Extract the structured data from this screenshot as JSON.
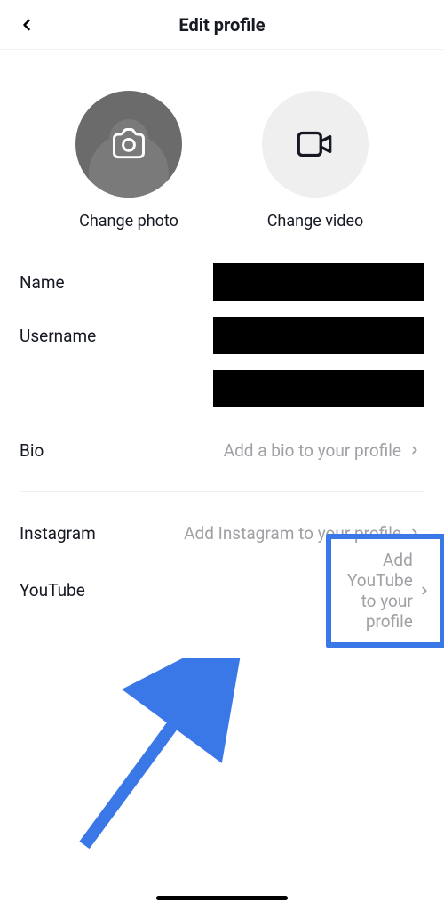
{
  "header": {
    "title": "Edit profile"
  },
  "media": {
    "photo_label": "Change photo",
    "video_label": "Change video"
  },
  "fields": {
    "name_label": "Name",
    "username_label": "Username",
    "bio_label": "Bio",
    "bio_placeholder": "Add a bio to your profile",
    "instagram_label": "Instagram",
    "instagram_placeholder": "Add Instagram to your profile",
    "youtube_label": "YouTube",
    "youtube_placeholder": "Add YouTube to your profile"
  },
  "icons": {
    "back": "chevron-left-icon",
    "camera": "camera-icon",
    "video": "video-camera-icon",
    "chevron": "chevron-right-icon"
  },
  "annotation": {
    "highlight_color": "#3b78e7"
  }
}
